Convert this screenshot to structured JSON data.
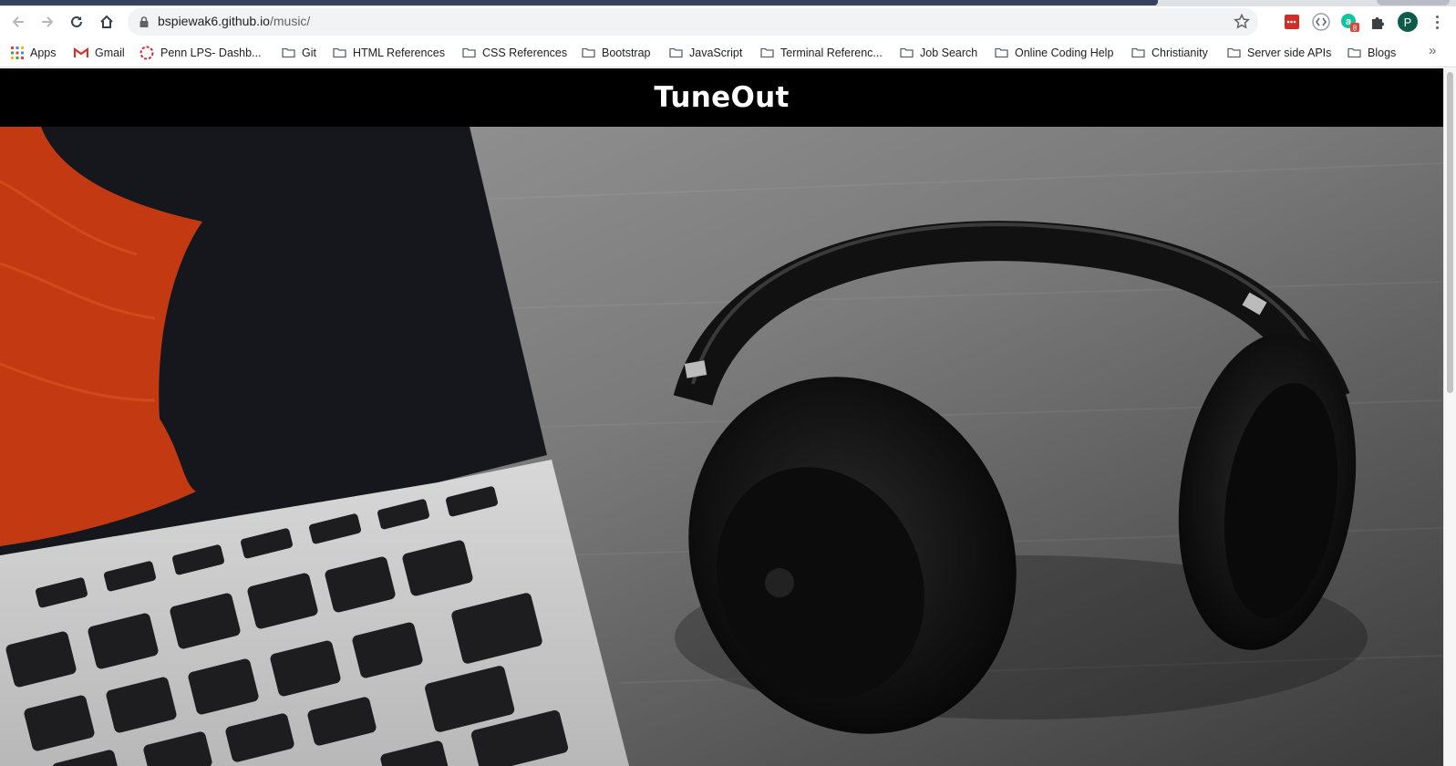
{
  "browser": {
    "url_host": "bspiewak6.github.io",
    "url_path": "/music/",
    "extension_badge": "8",
    "profile_initial": "P",
    "colors": {
      "tab_accent": "#35445c",
      "profile": "#0d5c4a"
    }
  },
  "bookmarks": {
    "items": [
      {
        "label": "Apps",
        "icon": "apps-grid-icon"
      },
      {
        "label": "Gmail",
        "icon": "gmail-icon"
      },
      {
        "label": "Penn LPS- Dashb...",
        "icon": "penn-icon"
      },
      {
        "label": "Git",
        "icon": "folder-icon"
      },
      {
        "label": "HTML References",
        "icon": "folder-icon"
      },
      {
        "label": "CSS References",
        "icon": "folder-icon"
      },
      {
        "label": "Bootstrap",
        "icon": "folder-icon"
      },
      {
        "label": "JavaScript",
        "icon": "folder-icon"
      },
      {
        "label": "Terminal Referenc...",
        "icon": "folder-icon"
      },
      {
        "label": "Job Search",
        "icon": "folder-icon"
      },
      {
        "label": "Online Coding Help",
        "icon": "folder-icon"
      },
      {
        "label": "Christianity",
        "icon": "folder-icon"
      },
      {
        "label": "Server side APIs",
        "icon": "folder-icon"
      },
      {
        "label": "Blogs",
        "icon": "folder-icon"
      }
    ],
    "overflow": "»"
  },
  "site": {
    "title": "TuneOut",
    "header_bg": "#000000",
    "hero_image": "laptop-and-headphones-photo"
  }
}
